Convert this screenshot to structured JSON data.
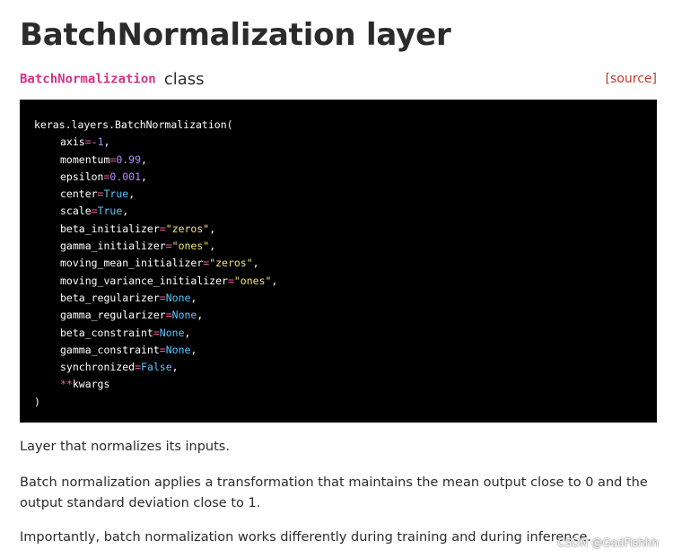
{
  "title": "BatchNormalization layer",
  "class_line": {
    "class_name": "BatchNormalization",
    "class_word": "class",
    "source_link": "[source]"
  },
  "code": {
    "line0": "keras.layers.BatchNormalization(",
    "args": [
      {
        "name": "axis",
        "value": "-1",
        "type": "num"
      },
      {
        "name": "momentum",
        "value": "0.99",
        "type": "num"
      },
      {
        "name": "epsilon",
        "value": "0.001",
        "type": "num"
      },
      {
        "name": "center",
        "value": "True",
        "type": "kw"
      },
      {
        "name": "scale",
        "value": "True",
        "type": "kw"
      },
      {
        "name": "beta_initializer",
        "value": "\"zeros\"",
        "type": "str"
      },
      {
        "name": "gamma_initializer",
        "value": "\"ones\"",
        "type": "str"
      },
      {
        "name": "moving_mean_initializer",
        "value": "\"zeros\"",
        "type": "str"
      },
      {
        "name": "moving_variance_initializer",
        "value": "\"ones\"",
        "type": "str"
      },
      {
        "name": "beta_regularizer",
        "value": "None",
        "type": "kw"
      },
      {
        "name": "gamma_regularizer",
        "value": "None",
        "type": "kw"
      },
      {
        "name": "beta_constraint",
        "value": "None",
        "type": "kw"
      },
      {
        "name": "gamma_constraint",
        "value": "None",
        "type": "kw"
      },
      {
        "name": "synchronized",
        "value": "False",
        "type": "kw"
      }
    ],
    "kwargs_op": "**",
    "kwargs_name": "kwargs",
    "closing": ")"
  },
  "paragraphs": {
    "p1": "Layer that normalizes its inputs.",
    "p2": "Batch normalization applies a transformation that maintains the mean output close to 0 and the output standard deviation close to 1.",
    "p3": "Importantly, batch normalization works differently during training and during inference."
  },
  "watermark": "CSDN @GodFishhh",
  "colors": {
    "class_name": "#d63384",
    "source_link": "#c0392b",
    "code_bg": "#000000",
    "code_operator": "#f0609a",
    "code_number": "#b48cff",
    "code_string": "#f2e56b",
    "code_keyword": "#57c7ff"
  }
}
